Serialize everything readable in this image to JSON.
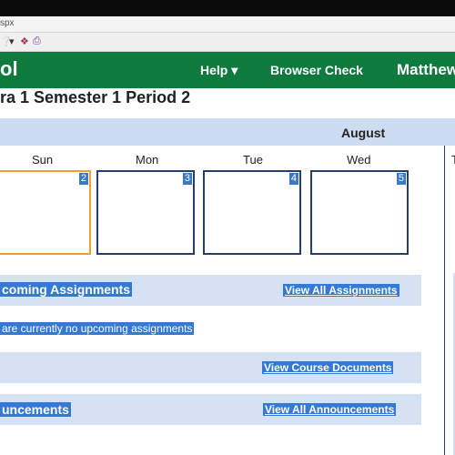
{
  "browser": {
    "address_fragment": "spx",
    "toolbar_icons": [
      "help-icon",
      "dropdown-arrow-icon",
      "research-icon",
      "print-icon"
    ]
  },
  "navbar": {
    "logo_text": "ol",
    "help_label": "Help ▾",
    "browser_check_label": "Browser Check",
    "user_label": "Matthew"
  },
  "page": {
    "course_title": "ra 1 Semester 1 Period 2"
  },
  "calendar": {
    "month": "August",
    "days": [
      {
        "name": "Sun",
        "num": "2"
      },
      {
        "name": "Mon",
        "num": "3"
      },
      {
        "name": "Tue",
        "num": "4"
      },
      {
        "name": "Wed",
        "num": "5"
      },
      {
        "name": "T",
        "num": ""
      }
    ]
  },
  "assignments": {
    "title": "coming Assignments",
    "link": "View All Assignments",
    "empty_message": "are currently no upcoming assignments"
  },
  "documents": {
    "link": "View Course Documents"
  },
  "announcements": {
    "title": "uncements",
    "link": "View All Announcements"
  },
  "colors": {
    "nav_green": "#0e7a3e",
    "section_bg": "#d5e2f4",
    "highlight_blue": "#3479d6",
    "today_border": "#f0a030",
    "cell_border": "#243e6e"
  }
}
